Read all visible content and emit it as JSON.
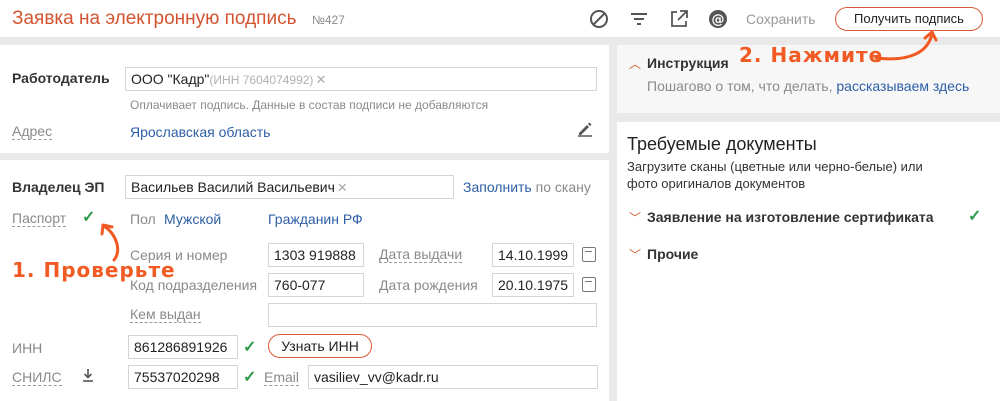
{
  "header": {
    "title": "Заявка на электронную подпись",
    "number": "№427",
    "save_label": "Сохранить",
    "get_sign_label": "Получить подпись"
  },
  "employer": {
    "label": "Работодатель",
    "value": "ООО \"Кадр\"",
    "inn_hint": "(ИНН 7604074992)",
    "hint": "Оплачивает подпись. Данные в состав подписи не добавляются",
    "address_label": "Адрес",
    "address_value": "Ярославская область"
  },
  "owner": {
    "label": "Владелец ЭП",
    "value": "Васильев Василий Васильевич",
    "fill_link": "Заполнить",
    "fill_suffix": "по скану",
    "passport_label": "Паспорт",
    "sex_label": "Пол",
    "sex_value": "Мужской",
    "citizenship": "Гражданин РФ",
    "series_label": "Серия и номер",
    "series_value": "1303 919888",
    "issue_date_label": "Дата выдачи",
    "issue_date_value": "14.10.1999",
    "division_label": "Код подразделения",
    "division_value": "760-077",
    "birth_label": "Дата рождения",
    "birth_value": "20.10.1975",
    "issued_by_label": "Кем выдан",
    "issued_by_value": "",
    "inn_label": "ИНН",
    "inn_value": "861286891926",
    "inn_button": "Узнать ИНН",
    "snils_label": "СНИЛС",
    "snils_value": "75537020298",
    "email_label": "Email",
    "email_value": "vasiliev_vv@kadr.ru"
  },
  "instruction": {
    "title": "Инструкция",
    "text": "Пошагово о том, что делать,",
    "link": "рассказываем здесь"
  },
  "documents": {
    "title": "Требуемые документы",
    "text_line1": "Загрузите сканы (цветные или черно-белые) или",
    "text_line2": "фото оригиналов документов",
    "items": [
      {
        "label": "Заявление на изготовление сертификата"
      },
      {
        "label": "Прочие"
      }
    ]
  },
  "annotations": {
    "step1": "1. Проверьте",
    "step2": "2. Нажмите"
  },
  "colors": {
    "accent": "#d35430",
    "link": "#2d5fa6",
    "check": "#2e9b4a",
    "annotation": "#f15a22"
  }
}
